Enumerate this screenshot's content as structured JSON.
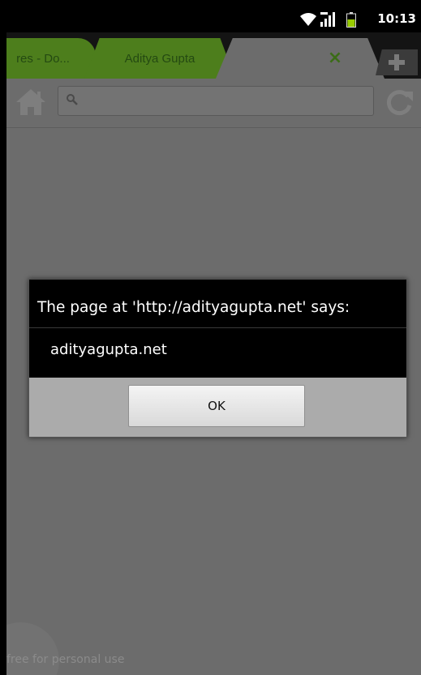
{
  "status_bar": {
    "time": "10:13"
  },
  "tabs": [
    {
      "title": "res - Do..."
    },
    {
      "title": "Aditya Gupta"
    },
    {
      "title": ""
    }
  ],
  "tab_close_glyph": "×",
  "url_bar": {
    "value": "",
    "placeholder": ""
  },
  "dialog": {
    "title": "The page at 'http://adityagupta.net' says:",
    "message": "adityagupta.net",
    "ok_label": "OK"
  },
  "watermark": "free for personal use",
  "colors": {
    "accent_green": "#4d7e1c",
    "dialog_bg": "#000000",
    "button_bar": "#ababab",
    "page_bg": "#6c6c6c"
  }
}
